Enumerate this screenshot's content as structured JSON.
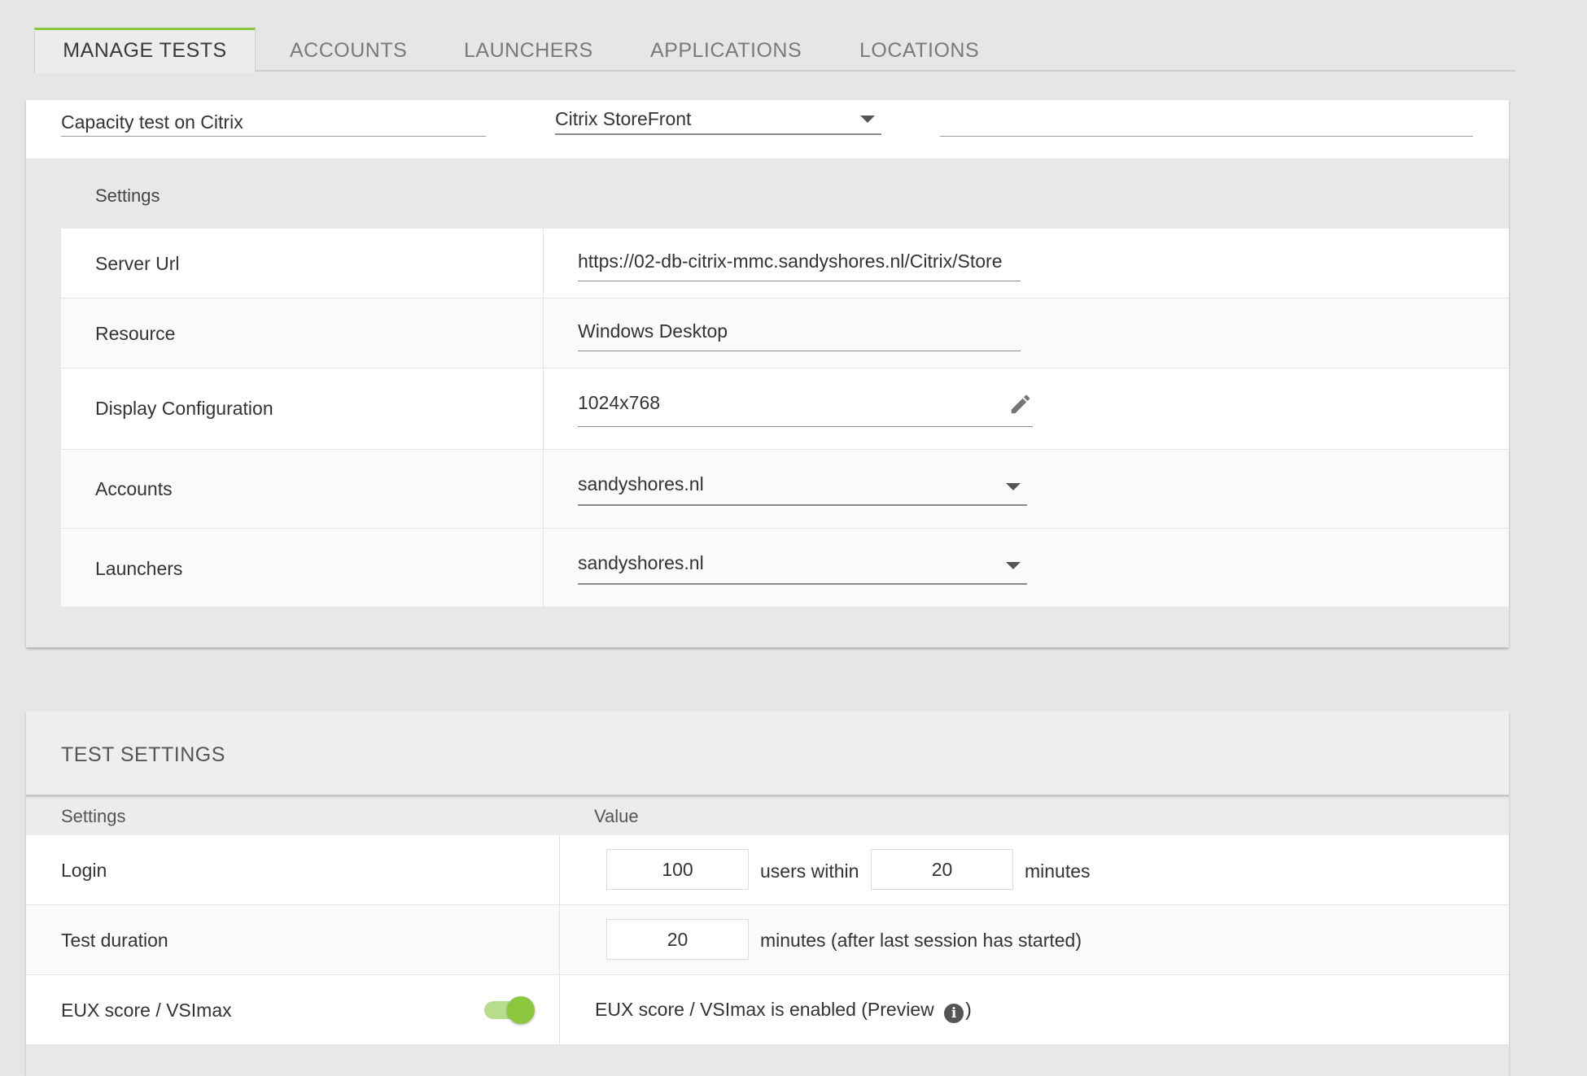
{
  "tabs": [
    {
      "label": "MANAGE TESTS",
      "active": true
    },
    {
      "label": "ACCOUNTS",
      "active": false
    },
    {
      "label": "LAUNCHERS",
      "active": false
    },
    {
      "label": "APPLICATIONS",
      "active": false
    },
    {
      "label": "LOCATIONS",
      "active": false
    }
  ],
  "connection": {
    "test_name": "Capacity test on Citrix",
    "connector": "Citrix StoreFront",
    "extra_field": ""
  },
  "connector_settings": {
    "heading": "Settings",
    "rows": [
      {
        "label": "Server Url",
        "value": "https://02-db-citrix-mmc.sandyshores.nl/Citrix/Store"
      },
      {
        "label": "Resource",
        "value": "Windows Desktop"
      },
      {
        "label": "Display Configuration",
        "value": "1024x768",
        "icon": "pencil-icon"
      },
      {
        "label": "Accounts",
        "value": "sandyshores.nl",
        "icon": "chevron-down-icon"
      },
      {
        "label": "Launchers",
        "value": "sandyshores.nl",
        "icon": "chevron-down-icon"
      }
    ]
  },
  "test_settings": {
    "title": "TEST SETTINGS",
    "col_settings": "Settings",
    "col_value": "Value",
    "login": {
      "label": "Login",
      "users": "100",
      "users_text": "users within",
      "minutes": "20",
      "minutes_text": "minutes"
    },
    "duration": {
      "label": "Test duration",
      "value": "20",
      "text": "minutes (after last session has started)"
    },
    "eux": {
      "label": "EUX score / VSImax",
      "enabled": true,
      "text": "EUX score / VSImax is enabled (Preview",
      "close_paren": ")",
      "icon": "info-icon"
    }
  },
  "colors": {
    "accent": "#8cc63f"
  }
}
